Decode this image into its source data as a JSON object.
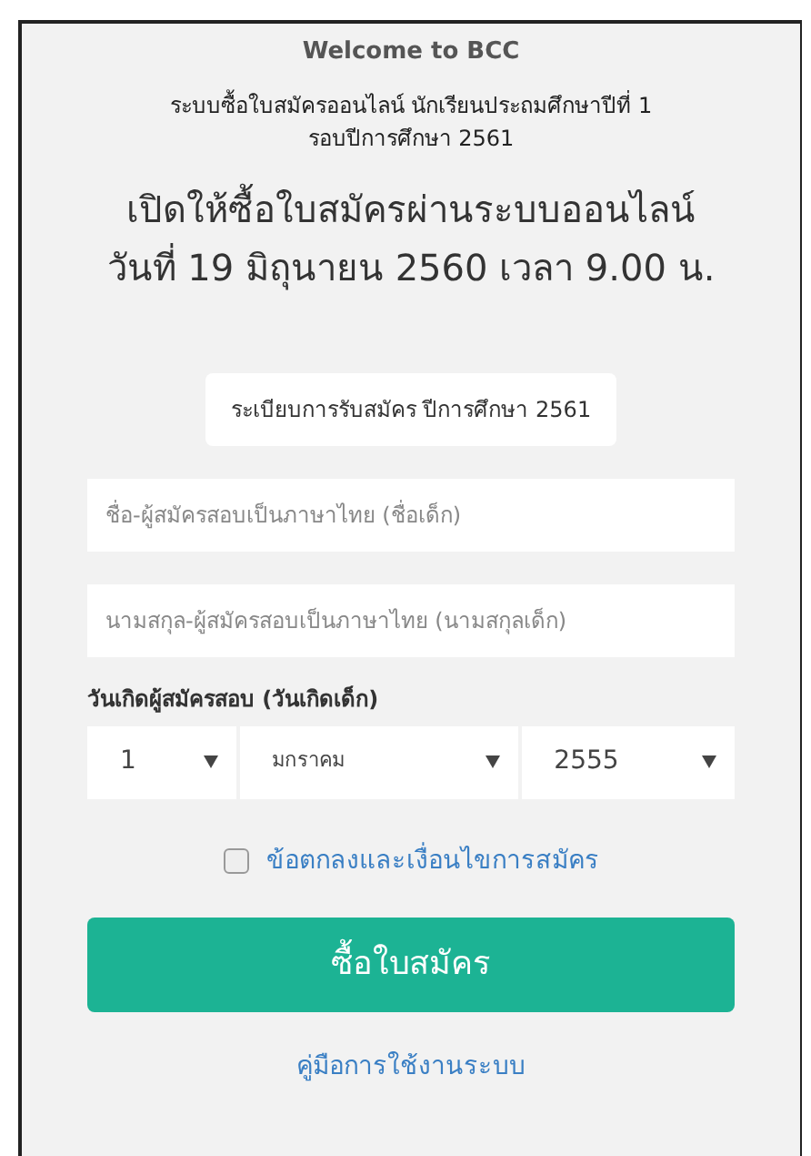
{
  "welcome": "Welcome to BCC",
  "subtitle_lines": [
    "ระบบซื้อใบสมัครออนไลน์ นักเรียนประถมศึกษาปีที่ 1",
    "รอบปีการศึกษา 2561"
  ],
  "headline_lines": [
    "เปิดให้ซื้อใบสมัครผ่านระบบออนไลน์",
    "วันที่ 19 มิถุนายน 2560 เวลา 9.00 น."
  ],
  "rules_button": "ระเบียบการรับสมัคร ปีการศึกษา 2561",
  "first_name": {
    "placeholder": "ชื่อ-ผู้สมัครสอบเป็นภาษาไทย (ชื่อเด็ก)"
  },
  "last_name": {
    "placeholder": "นามสกุล-ผู้สมัครสอบเป็นภาษาไทย (นามสกุลเด็ก)"
  },
  "birthdate_label": "วันเกิดผู้สมัครสอบ (วันเกิดเด็ก)",
  "birthdate_selects": [
    {
      "value": "1"
    },
    {
      "value": "มกราคม"
    },
    {
      "value": "2555"
    }
  ],
  "terms": {
    "label": "ข้อตกลงและเงื่อนไขการสมัคร",
    "checked": false
  },
  "submit_button": "ซื้อใบสมัคร",
  "manual_link": "คู่มือการใช้งานระบบ"
}
